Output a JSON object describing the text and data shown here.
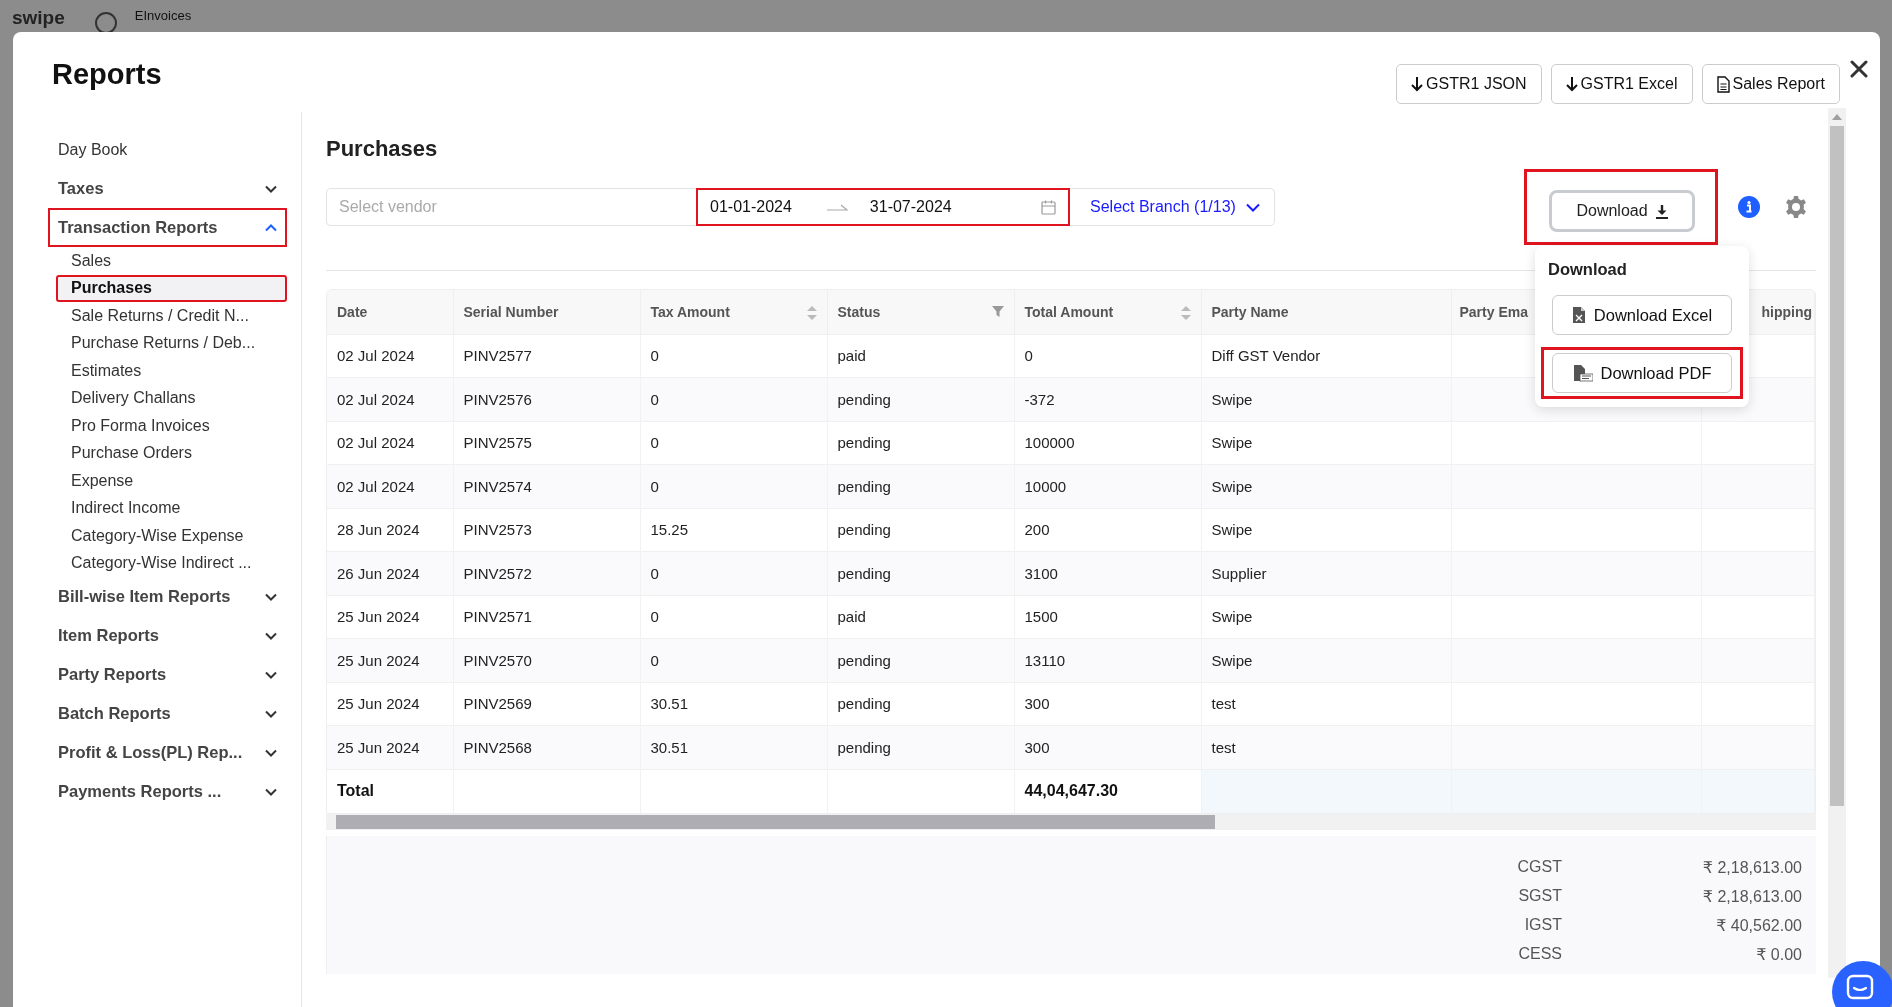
{
  "background_header": {
    "logo": "swipe",
    "section": "EInvoices"
  },
  "modal": {
    "title": "Reports",
    "actions": [
      {
        "label": "GSTR1 JSON",
        "kind": "download"
      },
      {
        "label": "GSTR1 Excel",
        "kind": "download"
      },
      {
        "label": "Sales Report",
        "kind": "file"
      }
    ]
  },
  "sidebar": {
    "items": [
      {
        "label": "Day Book",
        "kind": "link"
      },
      {
        "label": "Taxes",
        "kind": "group",
        "expanded": false,
        "highlighted": false
      },
      {
        "label": "Transaction Reports",
        "kind": "group",
        "expanded": true,
        "highlighted": true,
        "children": [
          {
            "label": "Sales",
            "selected": false,
            "highlighted": false
          },
          {
            "label": "Purchases",
            "selected": true,
            "highlighted": true
          },
          {
            "label": "Sale Returns / Credit N...",
            "selected": false,
            "highlighted": false
          },
          {
            "label": "Purchase Returns / Deb...",
            "selected": false,
            "highlighted": false
          },
          {
            "label": "Estimates",
            "selected": false,
            "highlighted": false
          },
          {
            "label": "Delivery Challans",
            "selected": false,
            "highlighted": false
          },
          {
            "label": "Pro Forma Invoices",
            "selected": false,
            "highlighted": false
          },
          {
            "label": "Purchase Orders",
            "selected": false,
            "highlighted": false
          },
          {
            "label": "Expense",
            "selected": false,
            "highlighted": false
          },
          {
            "label": "Indirect Income",
            "selected": false,
            "highlighted": false
          },
          {
            "label": "Category-Wise Expense",
            "selected": false,
            "highlighted": false
          },
          {
            "label": "Category-Wise Indirect ...",
            "selected": false,
            "highlighted": false
          }
        ]
      },
      {
        "label": "Bill-wise Item Reports",
        "kind": "group",
        "expanded": false,
        "highlighted": false
      },
      {
        "label": "Item Reports",
        "kind": "group",
        "expanded": false,
        "highlighted": false
      },
      {
        "label": "Party Reports",
        "kind": "group",
        "expanded": false,
        "highlighted": false
      },
      {
        "label": "Batch Reports",
        "kind": "group",
        "expanded": false,
        "highlighted": false
      },
      {
        "label": "Profit & Loss(PL) Rep...",
        "kind": "group",
        "expanded": false,
        "highlighted": false
      },
      {
        "label": "Payments Reports ...",
        "kind": "group",
        "expanded": false,
        "highlighted": false
      }
    ]
  },
  "report": {
    "title": "Purchases",
    "filters": {
      "vendor": {
        "placeholder": "Select vendor"
      },
      "date_from": "01-01-2024",
      "date_to": "31-07-2024",
      "date_highlighted": true,
      "branch": "Select Branch (1/13)"
    },
    "download": {
      "label": "Download",
      "highlighted": true,
      "menu": {
        "title": "Download",
        "items": [
          {
            "label": "Download Excel",
            "kind": "excel",
            "highlighted": false
          },
          {
            "label": "Download PDF",
            "kind": "pdf",
            "highlighted": true
          }
        ]
      }
    },
    "table": {
      "columns": [
        {
          "label": "Date",
          "sortable": false,
          "filterable": false
        },
        {
          "label": "Serial Number",
          "sortable": false,
          "filterable": false
        },
        {
          "label": "Tax Amount",
          "sortable": true,
          "filterable": false
        },
        {
          "label": "Status",
          "sortable": false,
          "filterable": true
        },
        {
          "label": "Total Amount",
          "sortable": true,
          "filterable": false
        },
        {
          "label": "Party Name",
          "sortable": false,
          "filterable": false
        },
        {
          "label": "Party Ema"
        },
        {
          "label": "hipping"
        }
      ],
      "rows": [
        [
          "02 Jul 2024",
          "PINV2577",
          "0",
          "paid",
          "0",
          "Diff GST Vendor"
        ],
        [
          "02 Jul 2024",
          "PINV2576",
          "0",
          "pending",
          "-372",
          "Swipe"
        ],
        [
          "02 Jul 2024",
          "PINV2575",
          "0",
          "pending",
          "100000",
          "Swipe"
        ],
        [
          "02 Jul 2024",
          "PINV2574",
          "0",
          "pending",
          "10000",
          "Swipe"
        ],
        [
          "28 Jun 2024",
          "PINV2573",
          "15.25",
          "pending",
          "200",
          "Swipe"
        ],
        [
          "26 Jun 2024",
          "PINV2572",
          "0",
          "pending",
          "3100",
          "Supplier"
        ],
        [
          "25 Jun 2024",
          "PINV2571",
          "0",
          "paid",
          "1500",
          "Swipe"
        ],
        [
          "25 Jun 2024",
          "PINV2570",
          "0",
          "pending",
          "13110",
          "Swipe"
        ],
        [
          "25 Jun 2024",
          "PINV2569",
          "30.51",
          "pending",
          "300",
          "test"
        ],
        [
          "25 Jun 2024",
          "PINV2568",
          "30.51",
          "pending",
          "300",
          "test"
        ]
      ],
      "total": {
        "label": "Total",
        "total_amount": "44,04,647.30"
      }
    },
    "summary": [
      {
        "label": "CGST",
        "value": "₹ 2,18,613.00"
      },
      {
        "label": "SGST",
        "value": "₹ 2,18,613.00"
      },
      {
        "label": "IGST",
        "value": "₹ 40,562.00"
      },
      {
        "label": "CESS",
        "value": "₹ 0.00"
      }
    ]
  }
}
